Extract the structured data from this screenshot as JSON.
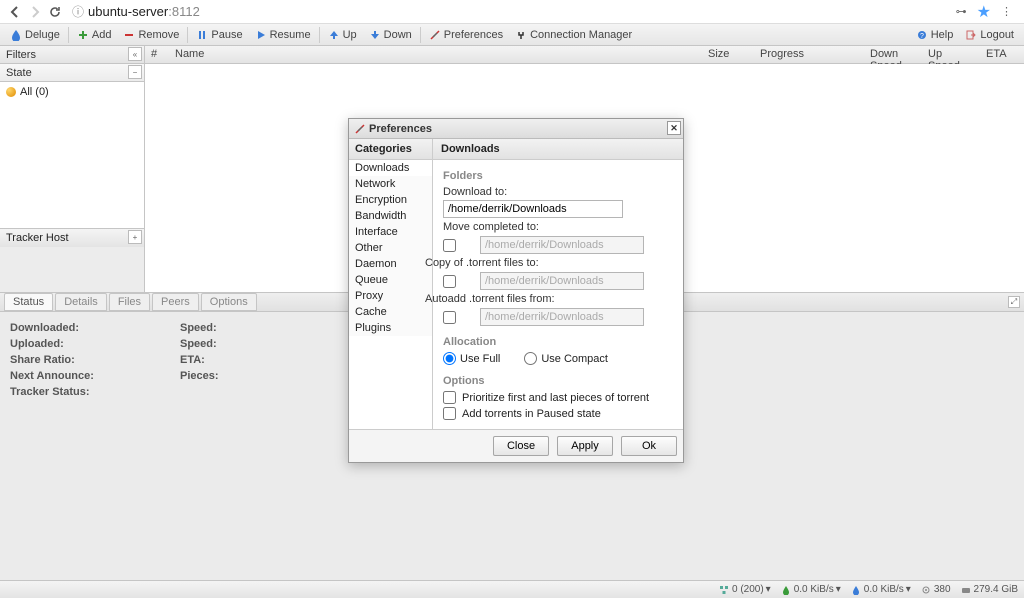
{
  "browser": {
    "url_host": "ubuntu-server",
    "url_port": ":8112",
    "info_prefix": "ⓘ"
  },
  "toolbar": {
    "brand": "Deluge",
    "add": "Add",
    "remove": "Remove",
    "pause": "Pause",
    "resume": "Resume",
    "up": "Up",
    "down": "Down",
    "preferences": "Preferences",
    "conn_mgr": "Connection Manager",
    "help": "Help",
    "logout": "Logout"
  },
  "sidebar": {
    "filters_label": "Filters",
    "state_label": "State",
    "all_label": "All (0)",
    "tracker_label": "Tracker Host"
  },
  "grid": {
    "cols": {
      "num": "#",
      "name": "Name",
      "size": "Size",
      "progress": "Progress",
      "down": "Down Speed",
      "up": "Up Speed",
      "eta": "ETA"
    }
  },
  "tabs": {
    "status": "Status",
    "details": "Details",
    "files": "Files",
    "peers": "Peers",
    "options": "Options"
  },
  "details": {
    "downloaded": "Downloaded:",
    "uploaded": "Uploaded:",
    "share_ratio": "Share Ratio:",
    "next_announce": "Next Announce:",
    "tracker_status": "Tracker Status:",
    "speed": "Speed:",
    "speed2": "Speed:",
    "eta": "ETA:",
    "pieces": "Pieces:"
  },
  "dialog": {
    "title": "Preferences",
    "categories_hdr": "Categories",
    "content_hdr": "Downloads",
    "categories": [
      "Downloads",
      "Network",
      "Encryption",
      "Bandwidth",
      "Interface",
      "Other",
      "Daemon",
      "Queue",
      "Proxy",
      "Cache",
      "Plugins"
    ],
    "folders_lbl": "Folders",
    "download_to": "Download to:",
    "download_to_val": "/home/derrik/Downloads",
    "move_completed": "Move completed to:",
    "move_completed_val": "/home/derrik/Downloads",
    "copy_torrent": "Copy of .torrent files to:",
    "copy_torrent_val": "/home/derrik/Downloads",
    "autoadd": "Autoadd .torrent files from:",
    "autoadd_val": "/home/derrik/Downloads",
    "allocation_lbl": "Allocation",
    "use_full": "Use Full",
    "use_compact": "Use Compact",
    "options_lbl": "Options",
    "prioritize": "Prioritize first and last pieces of torrent",
    "add_paused": "Add torrents in Paused state",
    "close": "Close",
    "apply": "Apply",
    "ok": "Ok"
  },
  "status_bar": {
    "conns": "0 (200)",
    "down": "0.0 KiB/s",
    "up": "0.0 KiB/s",
    "dht": "380",
    "disk": "279.4 GiB"
  }
}
